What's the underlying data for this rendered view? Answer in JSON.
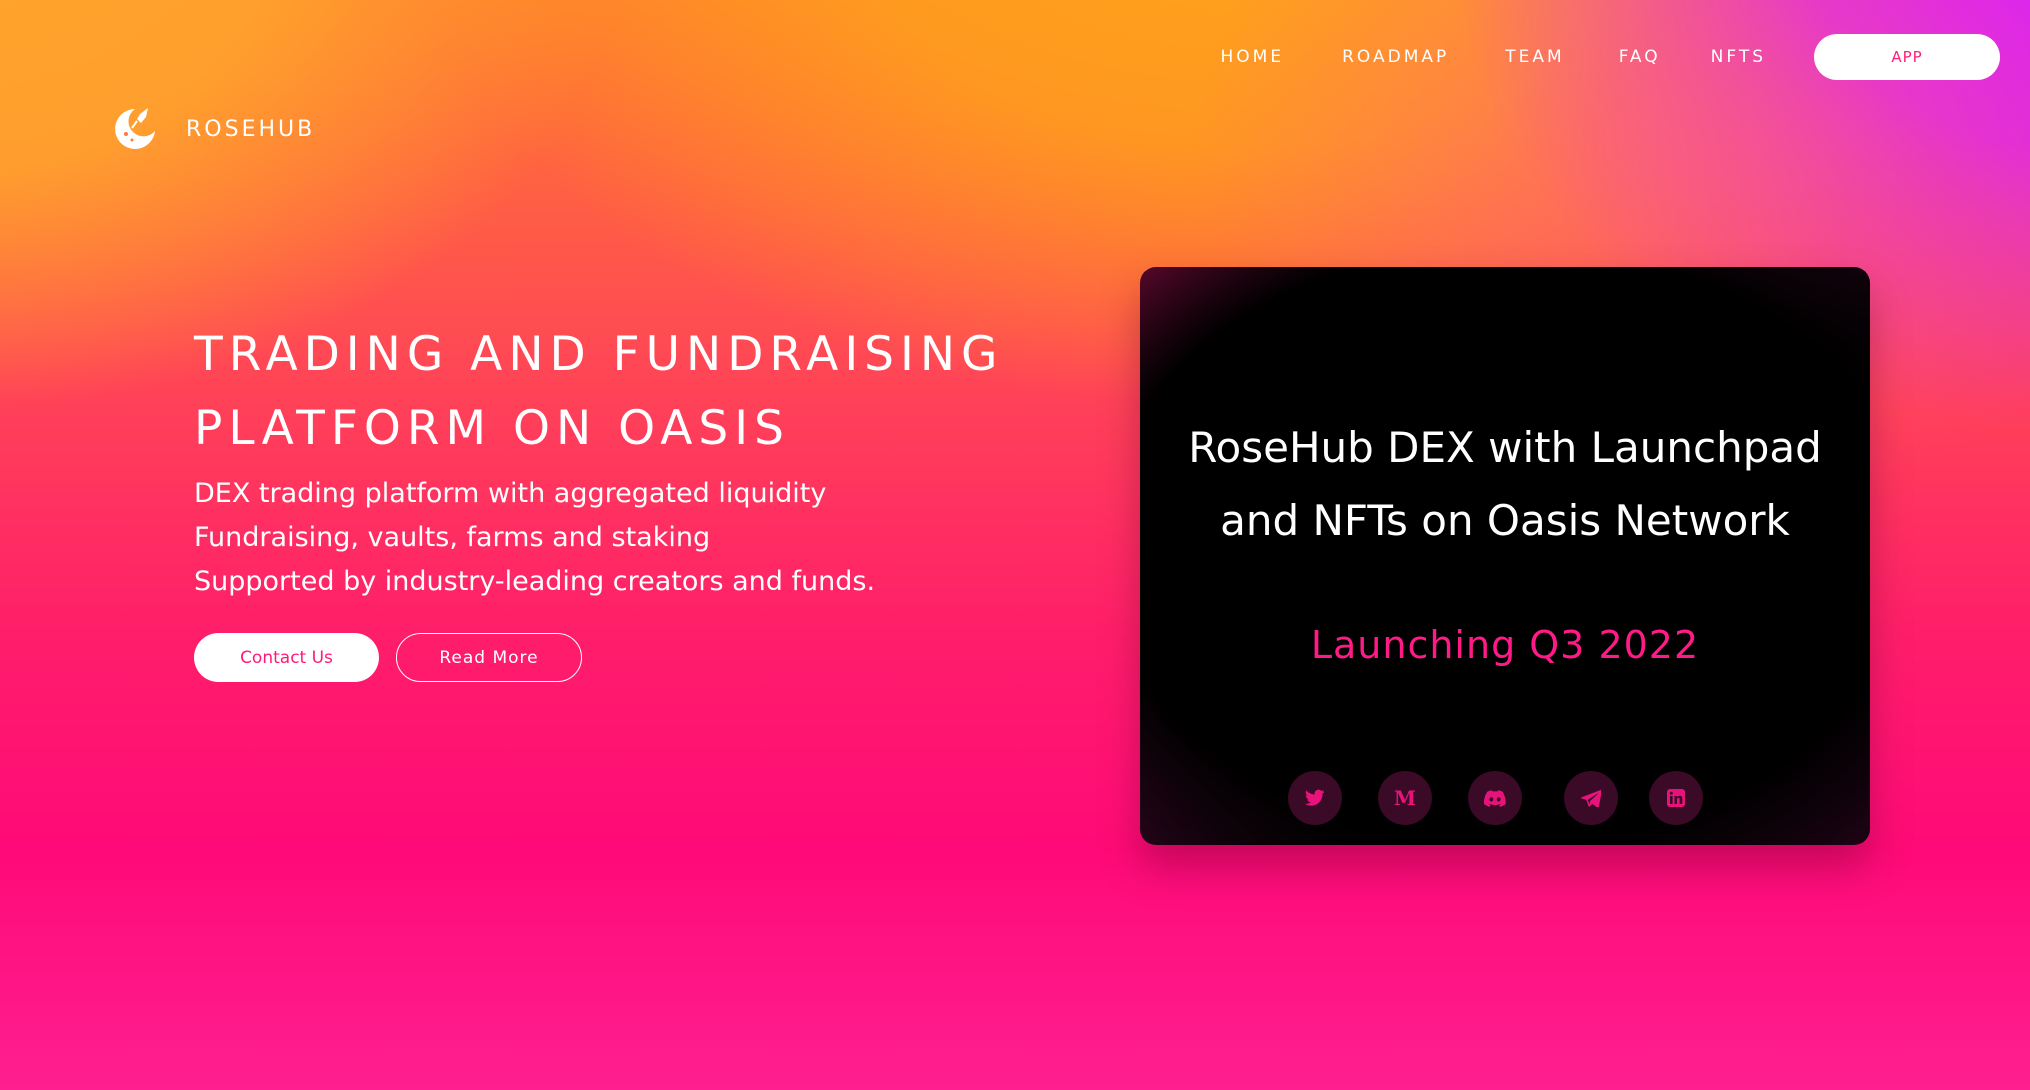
{
  "brand": {
    "name": "ROSEHUB",
    "logo_icon": "rocket-moon-icon"
  },
  "nav": {
    "items": [
      {
        "label": "HOME"
      },
      {
        "label": "ROADMAP"
      },
      {
        "label": "TEAM"
      },
      {
        "label": "FAQ"
      },
      {
        "label": "NFTS"
      }
    ],
    "app_label": "APP"
  },
  "hero": {
    "title_lines": [
      "TRADING AND FUNDRAISING",
      "PLATFORM ON OASIS"
    ],
    "subtitle_lines": [
      "DEX trading platform with aggregated liquidity",
      "Fundraising, vaults, farms and staking",
      "Supported by industry-leading creators and funds."
    ],
    "contact_label": "Contact Us",
    "read_more_label": "Read More"
  },
  "card": {
    "title_lines": [
      "RoseHub DEX with Launchpad",
      "and NFTs on Oasis Network"
    ],
    "launch_text": "Launching Q3 2022",
    "socials": [
      {
        "name": "twitter-icon"
      },
      {
        "name": "medium-icon",
        "glyph": "M"
      },
      {
        "name": "discord-icon"
      },
      {
        "name": "telegram-icon"
      },
      {
        "name": "linkedin-icon"
      }
    ]
  },
  "colors": {
    "accent_pink": "#ff1a88",
    "social_bg": "#3a0a26",
    "social_icon": "#e8137a",
    "gradient_orange": "#ffa21b",
    "gradient_magenta": "#d81cff",
    "gradient_pink": "#ff0a78"
  }
}
